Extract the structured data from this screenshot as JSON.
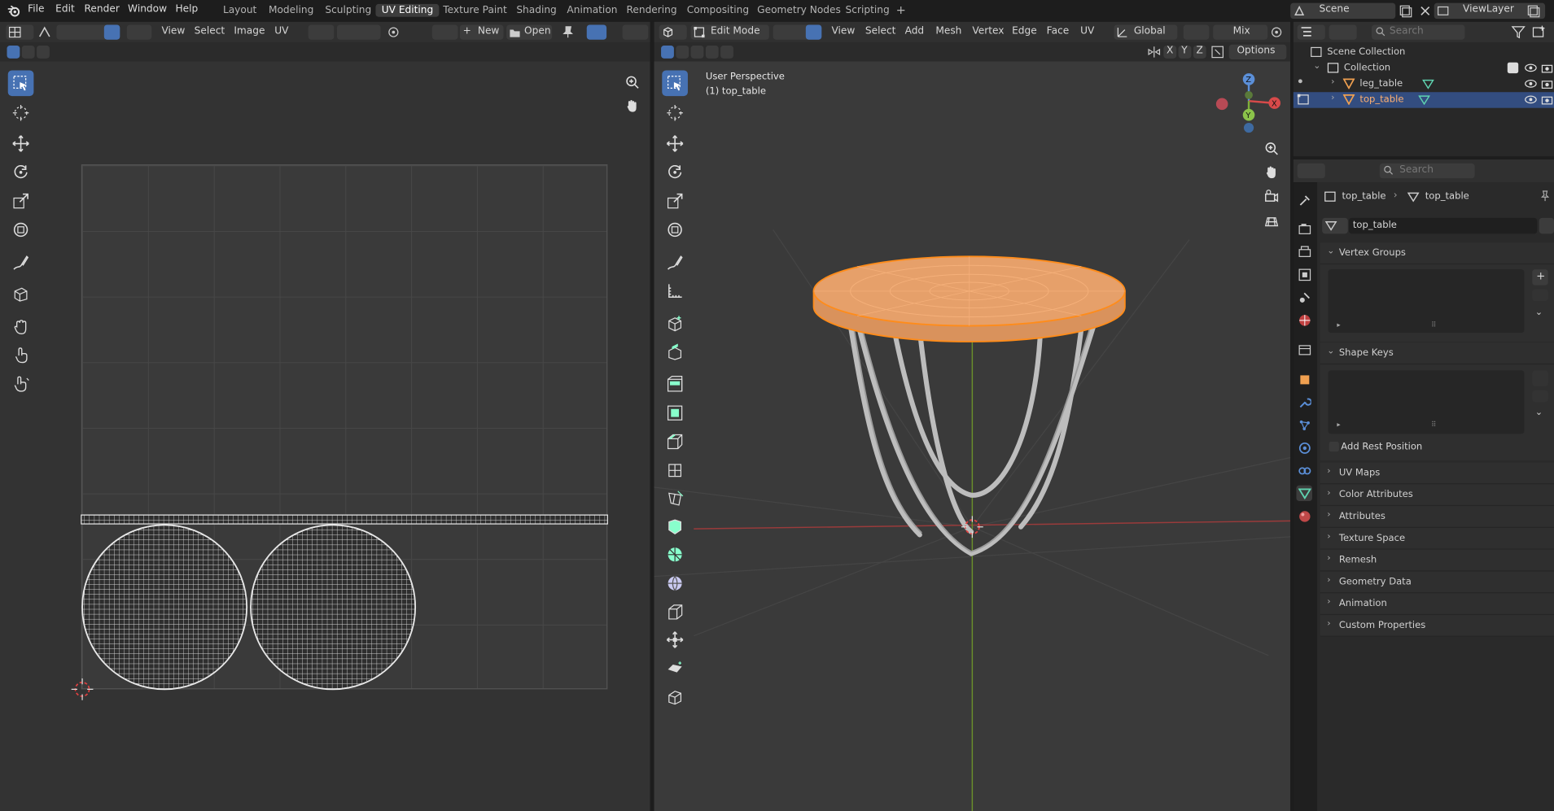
{
  "top_menu": {
    "file": "File",
    "edit": "Edit",
    "render": "Render",
    "window": "Window",
    "help": "Help"
  },
  "workspaces": [
    "Layout",
    "Modeling",
    "Sculpting",
    "UV Editing",
    "Texture Paint",
    "Shading",
    "Animation",
    "Rendering",
    "Compositing",
    "Geometry Nodes",
    "Scripting"
  ],
  "workspace_add": "+",
  "scene": {
    "name": "Scene",
    "view_layer": "ViewLayer"
  },
  "uv_header": {
    "view": "View",
    "select": "Select",
    "image": "Image",
    "uv": "UV",
    "new": "New",
    "open": "Open"
  },
  "viewport_header": {
    "mode": "Edit Mode",
    "view": "View",
    "select": "Select",
    "add": "Add",
    "mesh": "Mesh",
    "vertex": "Vertex",
    "edge": "Edge",
    "face": "Face",
    "uv": "UV",
    "orientation": "Global",
    "overlay_mode": "Mix",
    "options": "Options",
    "axis_x": "X",
    "axis_y": "Y",
    "axis_z": "Z"
  },
  "viewport": {
    "perspective": "User Perspective",
    "object_label": "(1) top_table"
  },
  "gizmo": {
    "x": "X",
    "y": "Y",
    "z": "Z"
  },
  "outliner": {
    "search_placeholder": "Search",
    "scene_collection": "Scene Collection",
    "collection": "Collection",
    "items": [
      "leg_table",
      "top_table"
    ]
  },
  "properties": {
    "search_placeholder": "Search",
    "breadcrumb_object": "top_table",
    "breadcrumb_mesh": "top_table",
    "mesh_name": "top_table",
    "add_rest_position": "Add Rest Position",
    "sections": [
      "Vertex Groups",
      "Shape Keys",
      "UV Maps",
      "Color Attributes",
      "Attributes",
      "Texture Space",
      "Remesh",
      "Geometry Data",
      "Animation",
      "Custom Properties"
    ]
  },
  "colors": {
    "accent": "#4772b3",
    "selection": "#ff8c1a",
    "header": "#303030",
    "background": "#1d1d1d",
    "viewport_bg": "#3a3a3a",
    "uv_bg": "#333333"
  }
}
